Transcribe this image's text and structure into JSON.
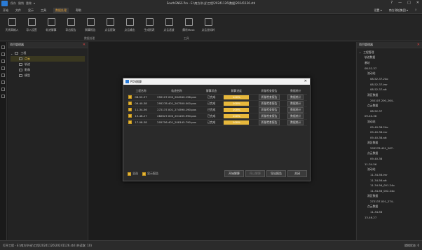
{
  "app": {
    "title": "SouthGNSS Pro - E:\\南方\\外业\\工程\\20241126\\数据\\20241126.std",
    "quick_access": [
      "保存",
      "撤销",
      "重做",
      "▾"
    ],
    "window_controls": [
      "?",
      "—",
      "□",
      "✕"
    ]
  },
  "menu": {
    "items": [
      "开始",
      "文件",
      "显示",
      "工具",
      "数据处理",
      "帮助"
    ],
    "active_index": 4,
    "right": [
      "设置 ▾",
      "南方测绘集团 ▾",
      "？"
    ]
  },
  "ribbon": {
    "buttons": [
      "天线高输入",
      "导入设置",
      "轨迹解算",
      "导出报告",
      "解算报告",
      "点云提取",
      "点云输出",
      "生成报表",
      "点云滤波",
      "解析Mask",
      "点云坐标转"
    ],
    "groups": [
      "数据处理",
      "工具"
    ]
  },
  "left_panel": {
    "title": "项目管理器",
    "tree": [
      {
        "label": "工程",
        "level": 0
      },
      {
        "label": "点云",
        "level": 1,
        "selected": true
      },
      {
        "label": "轨迹",
        "level": 1
      },
      {
        "label": "影像",
        "level": 1
      },
      {
        "label": "模型",
        "level": 1
      }
    ]
  },
  "right_panel": {
    "title": "项目管理器",
    "tree": [
      "工程管理",
      "轨迹数据",
      "基站",
      "08-52-37",
      "流动站",
      "08-52-37.24o",
      "08-52-37.imr",
      "08-52-37.att",
      "测区数据",
      "292107.200_264..",
      "点云数据",
      "08-52-37",
      "09-40-38",
      "流动站",
      "09-40-38.24o",
      "09-40-38.imr",
      "09-40-38.att",
      "测区数据",
      "295278.401_267..",
      "点云数据",
      "09-40-38",
      "11-34-56",
      "流动站",
      "11-34-56.imr",
      "11-34-56.att",
      "11-34-56_001.24o",
      "11-34-56_002.24o",
      "测区数据",
      "272137.001_274..",
      "点云数据",
      "11-34-56",
      "13-46-27"
    ]
  },
  "dialog": {
    "title": "POS解算",
    "close": "✕",
    "columns": [
      "",
      "工程名称",
      "轨迹名称",
      "解算状态",
      "解算进度",
      "质量检查报告",
      "数据统计"
    ],
    "rows": [
      {
        "project": "08-52-37",
        "trajectory": "292107.200_264940.196.pos",
        "status": "已完成",
        "progress": "100%",
        "report": "质量检查报告",
        "stats": "数据统计"
      },
      {
        "project": "09-40-38",
        "trajectory": "295278.401_267500.000.pos",
        "status": "已完成",
        "progress": "100%",
        "report": "质量检查报告",
        "stats": "数据统计"
      },
      {
        "project": "11-34-56",
        "trajectory": "272137.001_274590.190.pos",
        "status": "已完成",
        "progress": "100%",
        "report": "质量检查报告",
        "stats": "数据统计"
      },
      {
        "project": "13-46-27",
        "trajectory": "282627.000_201205.990.pos",
        "status": "已完成",
        "progress": "100%",
        "report": "质量检查报告",
        "stats": "数据统计"
      },
      {
        "project": "17-08-38",
        "trajectory": "205756.401_208145.790.pos",
        "status": "已完成",
        "progress": "100%",
        "report": "质量检查报告",
        "stats": "数据统计"
      }
    ],
    "footer": {
      "select_all": "全选",
      "show_chart": "显示报告",
      "start": "开始解算",
      "stop": "停止解算",
      "export": "导出报告",
      "close": "关闭"
    }
  },
  "status": {
    "left": "打开工程 - E:\\南方\\外业\\工程\\20241126\\20241126.std (共读取: 10)",
    "right": "就绪状态: 0"
  }
}
